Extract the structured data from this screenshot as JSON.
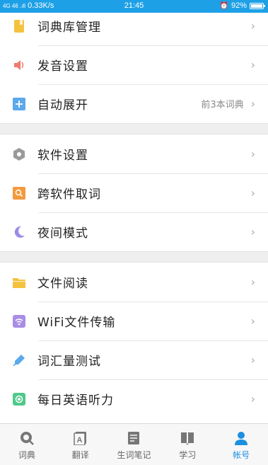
{
  "status_bar": {
    "network": "4G 46 .ıll",
    "speed": "0.33K/s",
    "time": "21:45",
    "alarm": "⏰",
    "battery": "92%",
    "battery_level": 0.92
  },
  "colors": {
    "statusbar": "#1ea0e6",
    "active_tab": "#1e8fe0"
  },
  "settings": {
    "group1": [
      {
        "label": "词典库管理",
        "icon": "dictionary-book-icon",
        "color": "#f5c23e"
      },
      {
        "label": "发音设置",
        "icon": "speaker-icon",
        "color": "#f07a6c"
      },
      {
        "label": "自动展开",
        "icon": "plus-square-icon",
        "color": "#5aa9ec",
        "value": "前3本词典"
      }
    ],
    "group2": [
      {
        "label": "软件设置",
        "icon": "hexagon-settings-icon",
        "color": "#9a9a9a"
      },
      {
        "label": "跨软件取词",
        "icon": "search-square-icon",
        "color": "#f39a3d"
      },
      {
        "label": "夜间模式",
        "icon": "moon-icon",
        "color": "#9b8ce8"
      }
    ],
    "group3": [
      {
        "label": "文件阅读",
        "icon": "folder-icon",
        "color": "#f5c23e"
      },
      {
        "label": "WiFi文件传输",
        "icon": "wifi-icon",
        "color": "#a98de6"
      },
      {
        "label": "词汇量测试",
        "icon": "pen-icon",
        "color": "#5aa9ec"
      },
      {
        "label": "每日英语听力",
        "icon": "headphone-icon",
        "color": "#4fc98b"
      }
    ],
    "chevron": "›"
  },
  "tabs": [
    {
      "label": "词典",
      "icon": "search-tab-icon"
    },
    {
      "label": "翻译",
      "icon": "translate-tab-icon"
    },
    {
      "label": "生词笔记",
      "icon": "notes-tab-icon"
    },
    {
      "label": "学习",
      "icon": "study-book-tab-icon"
    },
    {
      "label": "帐号",
      "icon": "account-tab-icon",
      "active": true
    }
  ]
}
